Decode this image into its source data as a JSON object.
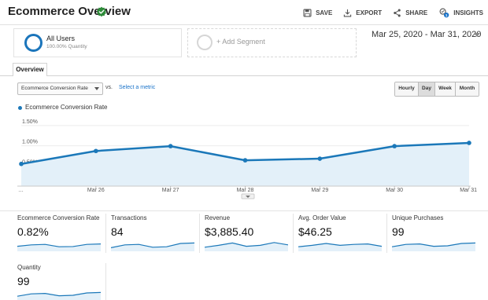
{
  "header": {
    "title": "Ecommerce Overview",
    "toolbar": {
      "save": "SAVE",
      "export": "EXPORT",
      "share": "SHARE",
      "insights": "INSIGHTS"
    }
  },
  "segments": {
    "all_users": {
      "name": "All Users",
      "quantity": "100.00% Quantity"
    },
    "add_label": "+ Add Segment"
  },
  "date_range": "Mar 25, 2020 - Mar 31, 2020",
  "tabs": [
    {
      "label": "Overview"
    }
  ],
  "controls": {
    "metric": "Ecommerce Conversion Rate",
    "vs": "vs.",
    "select_metric": "Select a metric",
    "granularity": [
      "Hourly",
      "Day",
      "Week",
      "Month"
    ],
    "granularity_active": "Day"
  },
  "colors": {
    "accent": "#1b78b9",
    "area_fill": "#e3f0f9",
    "check": "#2e8b3a"
  },
  "chart_data": {
    "type": "area",
    "series": [
      {
        "name": "Ecommerce Conversion Rate",
        "values": [
          0.55,
          0.87,
          0.99,
          0.64,
          0.68,
          0.99,
          1.07
        ]
      }
    ],
    "categories": [
      "…",
      "Mar 26",
      "Mar 27",
      "Mar 28",
      "Mar 29",
      "Mar 30",
      "Mar 31"
    ],
    "y_ticks": [
      "1.50%",
      "1.00%",
      "0.50%"
    ],
    "y_tick_values": [
      1.5,
      1.0,
      0.5
    ],
    "ylim": [
      0,
      1.75
    ],
    "grid": true,
    "legend": "top-left"
  },
  "scorecards": [
    {
      "title": "Ecommerce Conversion Rate",
      "value": "0.82%",
      "spark": [
        0.45,
        0.6,
        0.65,
        0.4,
        0.42,
        0.65,
        0.7
      ]
    },
    {
      "title": "Transactions",
      "value": "84",
      "spark": [
        0.3,
        0.6,
        0.65,
        0.35,
        0.4,
        0.75,
        0.8
      ]
    },
    {
      "title": "Revenue",
      "value": "$3,885.40",
      "spark": [
        0.35,
        0.55,
        0.8,
        0.45,
        0.55,
        0.85,
        0.6
      ]
    },
    {
      "title": "Avg. Order Value",
      "value": "$46.25",
      "spark": [
        0.4,
        0.55,
        0.75,
        0.55,
        0.65,
        0.7,
        0.45
      ]
    },
    {
      "title": "Unique Purchases",
      "value": "99",
      "spark": [
        0.4,
        0.65,
        0.7,
        0.45,
        0.5,
        0.75,
        0.8
      ]
    },
    {
      "title": "Quantity",
      "value": "99",
      "spark": [
        0.4,
        0.65,
        0.7,
        0.45,
        0.5,
        0.75,
        0.8
      ]
    }
  ]
}
